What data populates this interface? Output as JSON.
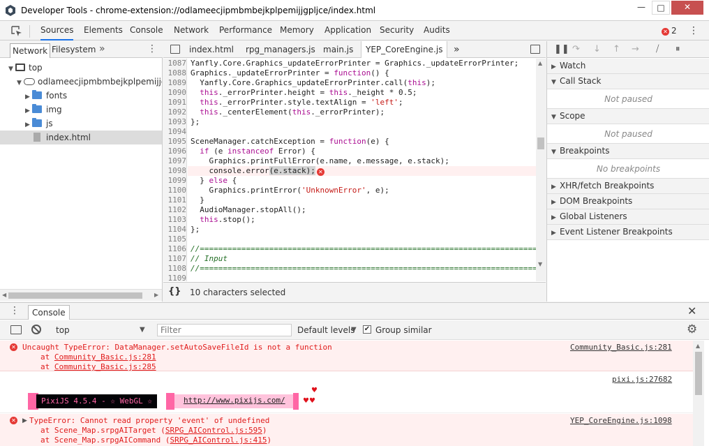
{
  "window": {
    "title": "Developer Tools - chrome-extension://odlameecjipmbmbejkplpemijjgpljce/index.html",
    "min": "—",
    "max": "□",
    "close": "✕"
  },
  "main_tabs": [
    "Sources",
    "Elements",
    "Console",
    "Network",
    "Performance",
    "Memory",
    "Application",
    "Security",
    "Audits"
  ],
  "error_count": "2",
  "navigator": {
    "tabs": [
      "Network",
      "Filesystem"
    ],
    "more": "»",
    "tree": [
      {
        "label": "top",
        "type": "frame",
        "depth": 0
      },
      {
        "label": "odlameecjipmbmbejkplpemijjgpljce",
        "type": "cloud",
        "depth": 1
      },
      {
        "label": "fonts",
        "type": "folder",
        "depth": 2
      },
      {
        "label": "img",
        "type": "folder",
        "depth": 2
      },
      {
        "label": "js",
        "type": "folder",
        "depth": 2
      },
      {
        "label": "index.html",
        "type": "file",
        "depth": 2,
        "selected": true
      }
    ]
  },
  "editor": {
    "tabs": [
      "index.html",
      "rpg_managers.js",
      "main.js",
      "YEP_CoreEngine.js"
    ],
    "active_tab": "YEP_CoreEngine.js",
    "more": "»",
    "lines": [
      1087,
      1088,
      1089,
      1090,
      1091,
      1092,
      1093,
      1094,
      1095,
      1096,
      1097,
      1098,
      1099,
      1100,
      1101,
      1102,
      1103,
      1104,
      1105,
      1106,
      1107,
      1108,
      1109
    ],
    "status": "10 characters selected",
    "format_icon": "{}"
  },
  "debugger": {
    "sections": [
      {
        "title": "Watch",
        "empty": ""
      },
      {
        "title": "Call Stack",
        "empty": "Not paused"
      },
      {
        "title": "Scope",
        "empty": "Not paused"
      },
      {
        "title": "Breakpoints",
        "empty": "No breakpoints"
      },
      {
        "title": "XHR/fetch Breakpoints",
        "empty": ""
      },
      {
        "title": "DOM Breakpoints",
        "empty": ""
      },
      {
        "title": "Global Listeners",
        "empty": ""
      },
      {
        "title": "Event Listener Breakpoints",
        "empty": ""
      }
    ]
  },
  "drawer": {
    "tab": "Console",
    "context": "top",
    "filter_placeholder": "Filter",
    "levels": "Default levels",
    "group_similar": "Group similar",
    "group_checked": "✔"
  },
  "console": {
    "msg1": {
      "text": "Uncaught TypeError: DataManager.setAutoSaveFileId is not a function",
      "at1": "Community_Basic.js:281",
      "at2": "Community_Basic.js:285",
      "source": "Community_Basic.js:281"
    },
    "msg2": {
      "source": "pixi.js:27682",
      "banner": "PixiJS 4.5.4 - ☆ WebGL ☆",
      "url": "http://www.pixijs.com/",
      "hearts": "♥♥",
      "heart_single": "♥"
    },
    "msg3": {
      "text": "TypeError: Cannot read property 'event' of undefined",
      "at1_fn": "Scene_Map.srpgAITarget",
      "at1_src": "SRPG_AIControl.js:595",
      "at2_fn": "Scene_Map.srpgAICommand",
      "at2_src": "SRPG_AIControl.js:415",
      "source": "YEP_CoreEngine.js:1098"
    }
  }
}
